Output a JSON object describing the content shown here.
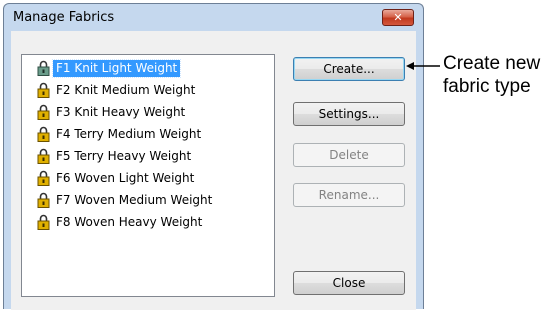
{
  "window": {
    "title": "Manage Fabrics",
    "close_glyph": "✕"
  },
  "fabrics": [
    {
      "label": "F1 Knit Light Weight",
      "selected": true,
      "icon": "lock-icon-open"
    },
    {
      "label": "F2 Knit Medium Weight",
      "selected": false,
      "icon": "lock-icon"
    },
    {
      "label": "F3 Knit Heavy Weight",
      "selected": false,
      "icon": "lock-icon"
    },
    {
      "label": "F4 Terry Medium Weight",
      "selected": false,
      "icon": "lock-icon"
    },
    {
      "label": "F5 Terry Heavy Weight",
      "selected": false,
      "icon": "lock-icon"
    },
    {
      "label": "F6 Woven Light Weight",
      "selected": false,
      "icon": "lock-icon"
    },
    {
      "label": "F7 Woven Medium Weight",
      "selected": false,
      "icon": "lock-icon"
    },
    {
      "label": "F8 Woven Heavy Weight",
      "selected": false,
      "icon": "lock-icon"
    }
  ],
  "buttons": {
    "create": "Create...",
    "settings": "Settings...",
    "delete": "Delete",
    "rename": "Rename...",
    "close": "Close"
  },
  "annotation": {
    "line1": "Create new",
    "line2": "fabric type"
  },
  "colors": {
    "selection": "#3399ff",
    "lock_body": "#e0b000",
    "lock_open_body": "#6a9c8a"
  }
}
